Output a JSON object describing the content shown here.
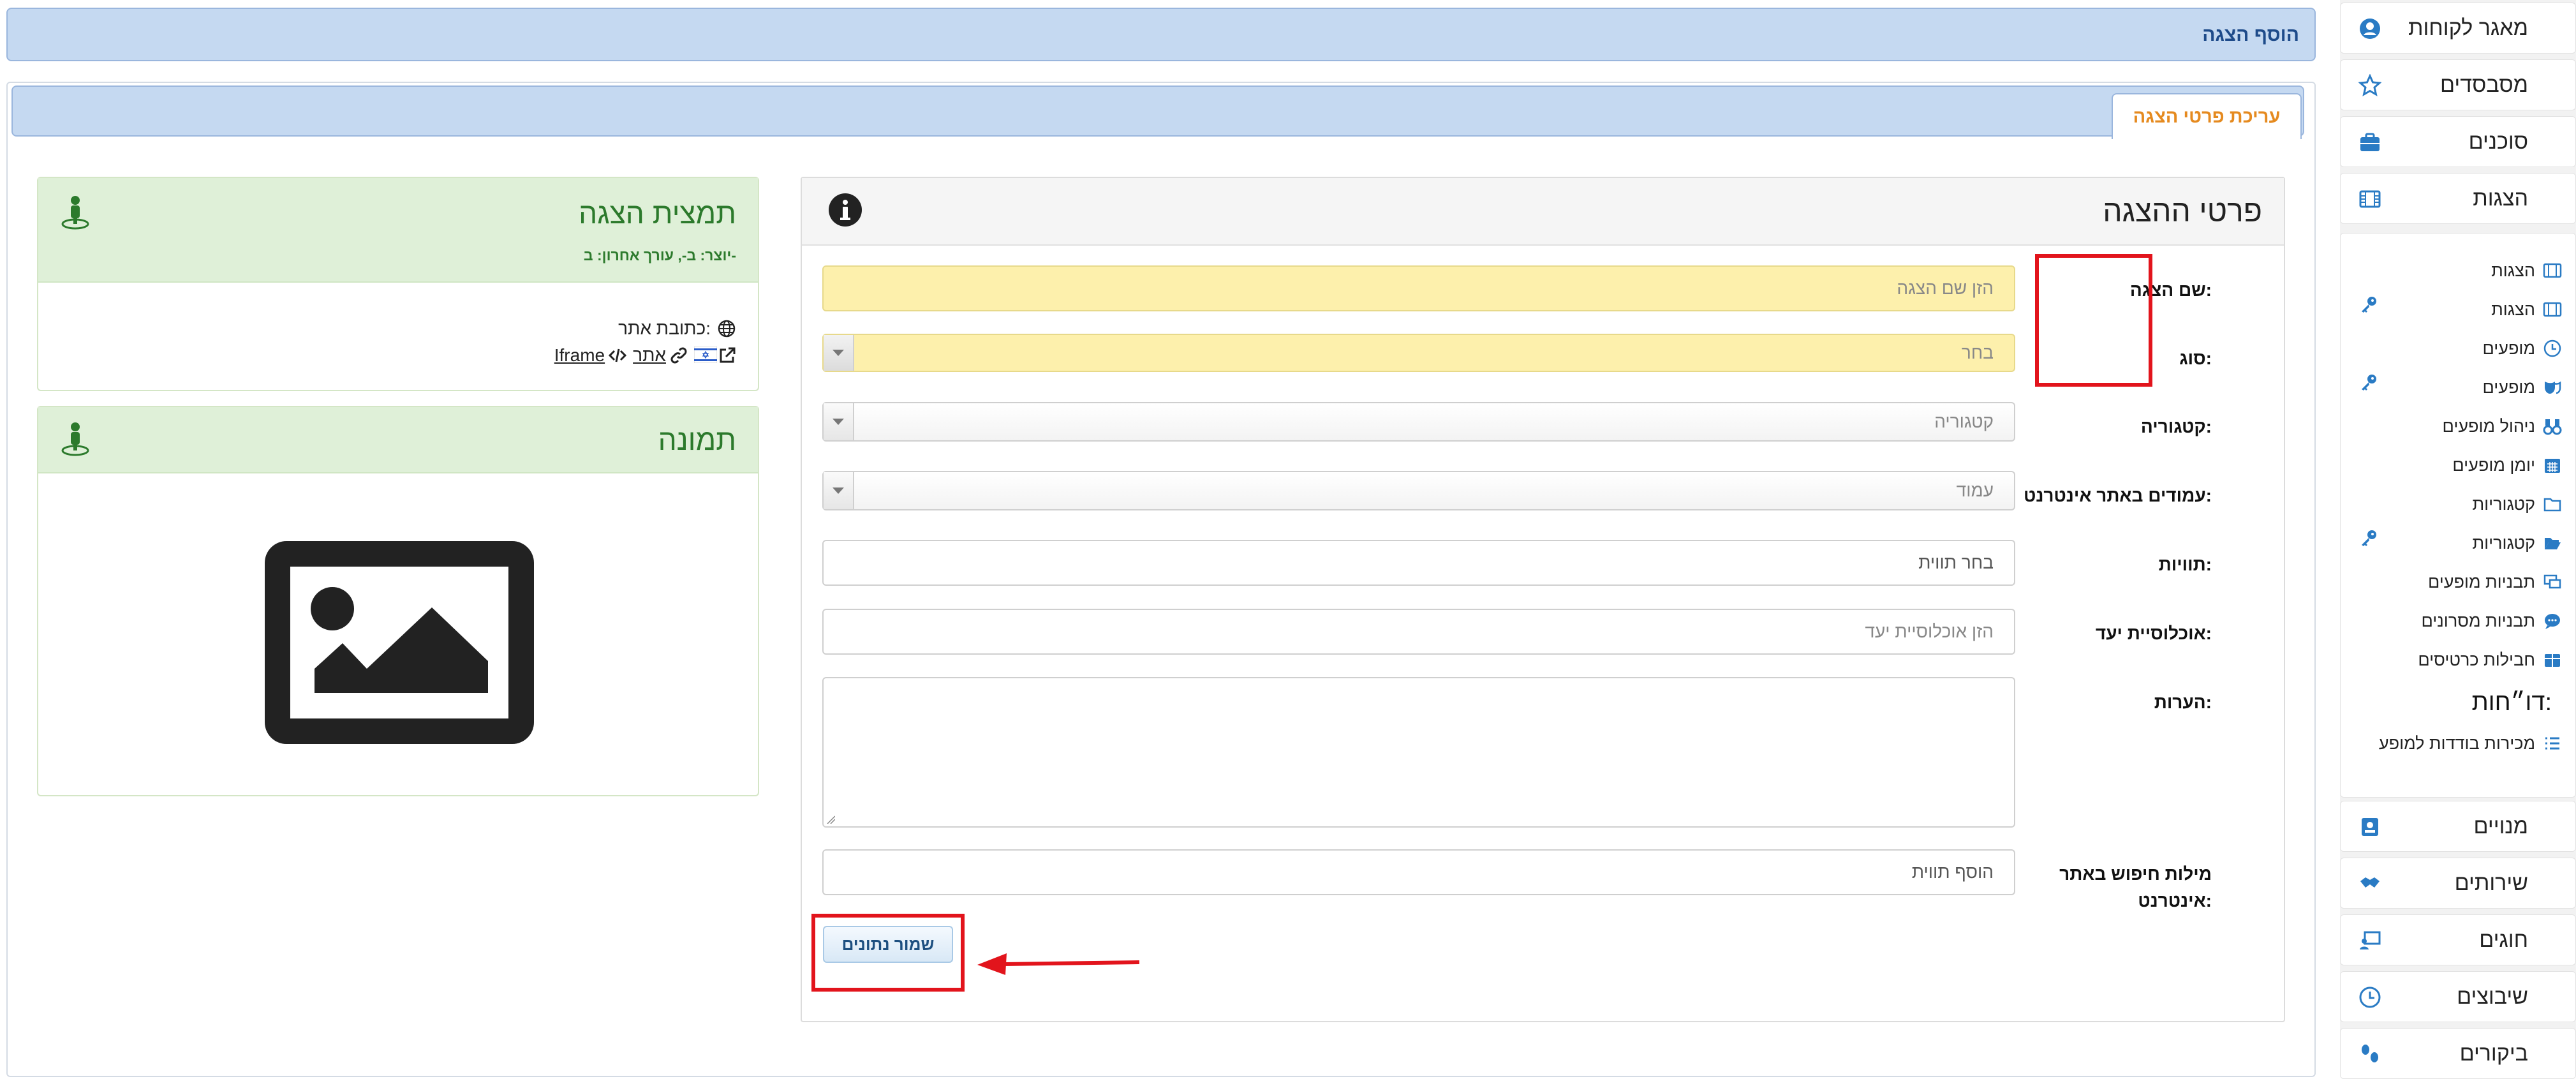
{
  "topbar": {
    "title": "הוסף הצגה"
  },
  "tab": {
    "label": "עריכת פרטי הצגה"
  },
  "sidebar": {
    "top_items": [
      {
        "label": "מאגר לקוחות",
        "icon": "user-circle-icon"
      },
      {
        "label": "מסבסדים",
        "icon": "star-icon"
      },
      {
        "label": "סוכנים",
        "icon": "briefcase-icon"
      },
      {
        "label": "הצגות",
        "icon": "film-icon"
      }
    ],
    "sub_items": [
      {
        "label": "הצגות",
        "icon": "film-icon"
      },
      {
        "label": "הצגות",
        "icon": "film-icon"
      },
      {
        "label": "מופעים",
        "icon": "clock-icon"
      },
      {
        "label": "מופעים",
        "icon": "masks-icon"
      },
      {
        "label": "ניהול מופעים",
        "icon": "binoculars-icon"
      },
      {
        "label": "יומן מופעים",
        "icon": "calendar-icon"
      },
      {
        "label": "קטגוריות",
        "icon": "folder-icon"
      },
      {
        "label": "קטגוריות",
        "icon": "folder-open-icon"
      },
      {
        "label": "תבניות מופעים",
        "icon": "screens-icon"
      },
      {
        "label": "תבניות מסרונים",
        "icon": "chat-icon"
      },
      {
        "label": "חבילות כרטיסים",
        "icon": "box-icon"
      }
    ],
    "reports_heading": "דו״חות:",
    "report_items": [
      {
        "label": "מכירות בודדות למופע",
        "icon": "list-icon"
      }
    ],
    "bottom_items": [
      {
        "label": "מנויים",
        "icon": "id-badge-icon"
      },
      {
        "label": "שירותים",
        "icon": "handshake-icon"
      },
      {
        "label": "חוגים",
        "icon": "teacher-icon"
      },
      {
        "label": "שיבוצים",
        "icon": "clock-icon"
      },
      {
        "label": "ביקורים",
        "icon": "footprints-icon"
      }
    ]
  },
  "form": {
    "title": "פרטי ההצגה",
    "name_label": "שם הצגה:",
    "name_placeholder": "הזן שם הצגה",
    "type_label": "סוג:",
    "type_placeholder": "בחר",
    "category_label": "קטגוריה:",
    "category_placeholder": "קטגוריה",
    "pages_label": "עמודים באתר אינטרנט:",
    "pages_placeholder": "עמוד",
    "tags_label": "תוויות:",
    "tags_placeholder": "בחר תווית",
    "audience_label": "אוכלוסיית יעד:",
    "audience_placeholder": "הזן אוכלוסיית יעד",
    "notes_label": "הערות:",
    "keywords_label_1": "מילות חיפוש באתר",
    "keywords_label_2": "אינטרנט:",
    "keywords_placeholder": "הוסף תווית",
    "save_label": "שמור נתונים"
  },
  "summary_card": {
    "title": "תמצית הצגה",
    "meta": "יוצר: ב-, עורך אחרון: ב-",
    "url_label": "כתובת אתר:",
    "link_site": "אתר",
    "link_iframe": "Iframe"
  },
  "image_card": {
    "title": "תמונה"
  },
  "colors": {
    "accent_blue": "#c5d9f1",
    "required_yellow": "#fdf0ac",
    "card_green": "#dff0d8",
    "annotation_red": "#e2141c",
    "tab_orange": "#e58a1f"
  }
}
